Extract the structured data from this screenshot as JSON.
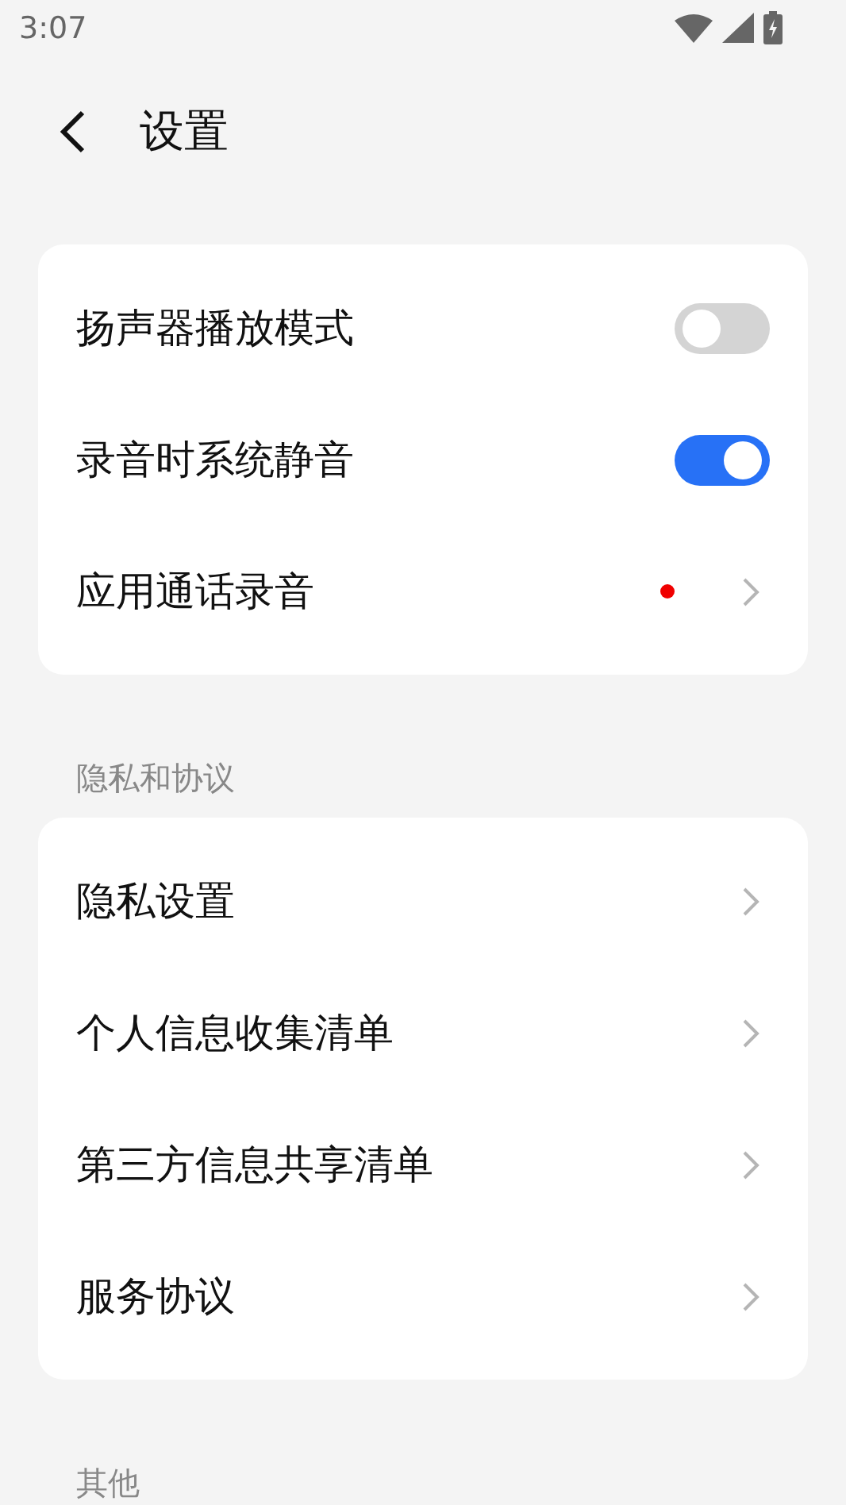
{
  "status_bar": {
    "time": "3:07"
  },
  "header": {
    "title": "设置"
  },
  "sections": [
    {
      "items": [
        {
          "kind": "toggle",
          "label": "扬声器播放模式",
          "on": false
        },
        {
          "kind": "toggle",
          "label": "录音时系统静音",
          "on": true
        },
        {
          "kind": "link",
          "label": "应用通话录音",
          "dot": true
        }
      ]
    },
    {
      "title": "隐私和协议",
      "items": [
        {
          "kind": "link",
          "label": "隐私设置",
          "dot": false
        },
        {
          "kind": "link",
          "label": "个人信息收集清单",
          "dot": false
        },
        {
          "kind": "link",
          "label": "第三方信息共享清单",
          "dot": false
        },
        {
          "kind": "link",
          "label": "服务协议",
          "dot": false
        }
      ]
    },
    {
      "title": "其他"
    }
  ]
}
